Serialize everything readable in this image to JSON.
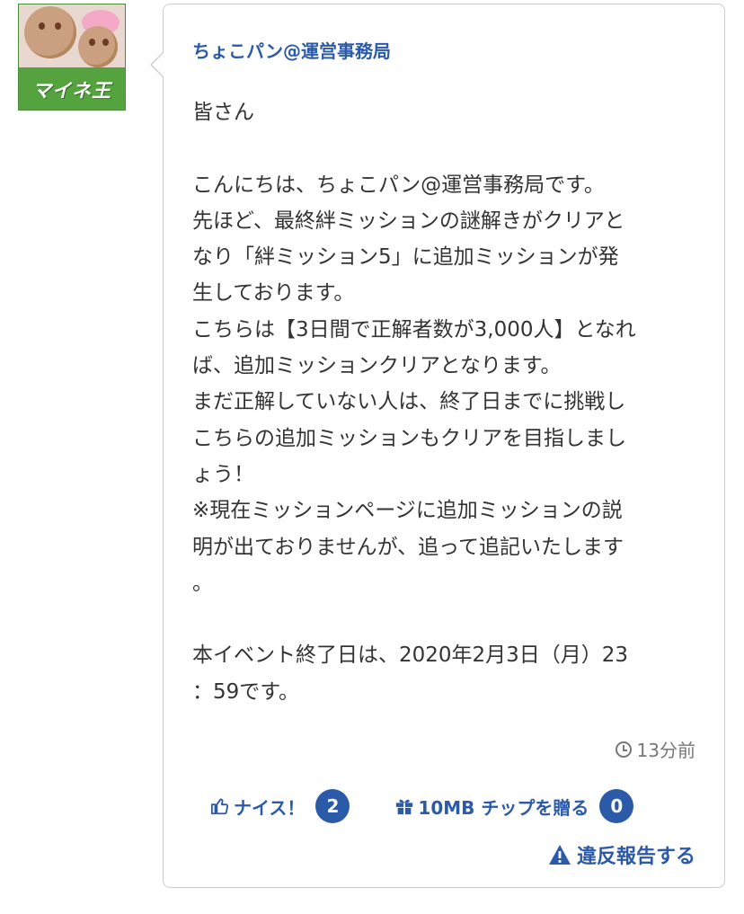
{
  "avatar": {
    "logo_text": "マイネ王"
  },
  "post": {
    "author": "ちょこパン@運営事務局",
    "lines": [
      "皆さん",
      "",
      "こんにちは、ちょこパン@運営事務局です。",
      "先ほど、最終絆ミッションの謎解きがクリアと",
      "なり「絆ミッション5」に追加ミッションが発",
      "生しております。",
      "こちらは【3日間で正解者数が3,000人】となれ",
      "ば、追加ミッションクリアとなります。",
      "まだ正解していない人は、終了日までに挑戦し",
      "こちらの追加ミッションもクリアを目指しまし",
      "ょう！",
      "※現在ミッションページに追加ミッションの説",
      "明が出ておりませんが、追って追記いたします",
      "。",
      "",
      "本イベント終了日は、2020年2月3日（月）23",
      "：59です。"
    ],
    "timestamp": "13分前"
  },
  "actions": {
    "nice_label": "ナイス！",
    "nice_count": "2",
    "tip_label": "10MB チップを贈る",
    "tip_count": "0",
    "report_label": "違反報告する"
  },
  "colors": {
    "link": "#2b5aa8",
    "border": "#cccccc",
    "text": "#333333",
    "muted": "#777777"
  }
}
